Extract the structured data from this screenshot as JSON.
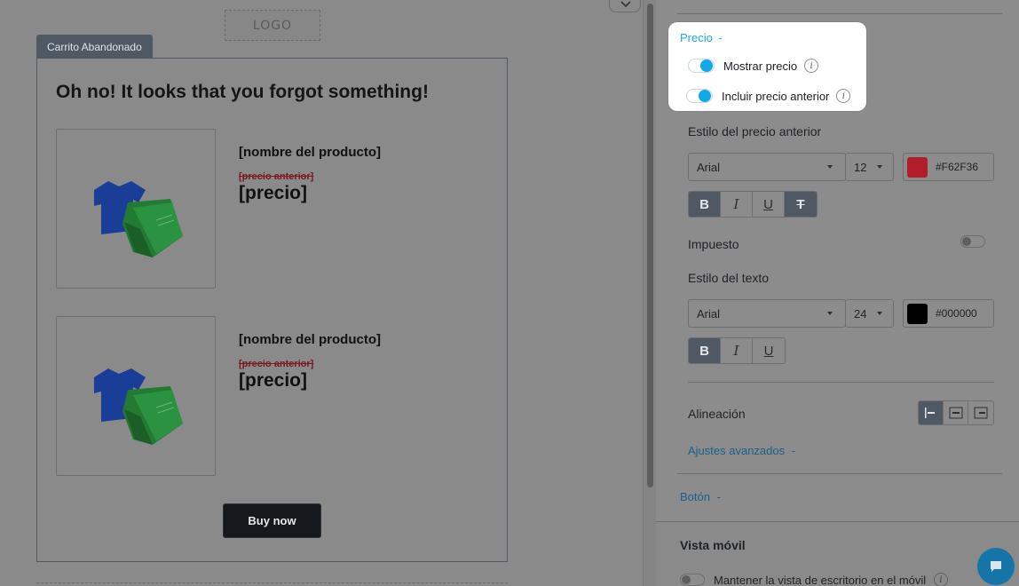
{
  "canvas": {
    "logo_text": "LOGO",
    "block_tab": "Carrito Abandonado",
    "heading": "Oh no! It looks that you forgot something!",
    "products": [
      {
        "name": "[nombre del producto]",
        "old_price": "[precio anterior]",
        "price": "[precio]"
      },
      {
        "name": "[nombre del producto]",
        "old_price": "[precio anterior]",
        "price": "[precio]"
      }
    ],
    "buy_button": "Buy now"
  },
  "panel": {
    "price_section": {
      "title": "Precio",
      "collapse_glyph": "-",
      "toggles": [
        {
          "label": "Mostrar precio",
          "on": true
        },
        {
          "label": "Incluir precio anterior",
          "on": true
        }
      ]
    },
    "old_price_style": {
      "label": "Estilo del precio anterior",
      "font": "Arial",
      "size": "12",
      "color_hex": "#F62F36",
      "swatch_color": "#b11d28",
      "format_buttons": [
        "B",
        "I",
        "U",
        "T"
      ],
      "active_buttons": [
        "B",
        "T"
      ]
    },
    "tax": {
      "label": "Impuesto",
      "on": false
    },
    "text_style": {
      "label": "Estilo del texto",
      "font": "Arial",
      "size": "24",
      "color_hex": "#000000",
      "swatch_color": "#000000",
      "format_buttons": [
        "B",
        "I",
        "U"
      ],
      "active_buttons": [
        "B"
      ]
    },
    "alignment": {
      "label": "Alineación",
      "options": [
        "left",
        "center",
        "right"
      ],
      "active": "left"
    },
    "advanced_link": "Ajustes avanzados",
    "advanced_glyph": "-",
    "button_section": "Botón",
    "button_glyph": "-",
    "mobile": {
      "title": "Vista móvil",
      "keep_desktop_label": "Mantener la vista de escritorio en el móvil",
      "keep_desktop_on": false
    }
  },
  "colors": {
    "accent": "#12a9ea",
    "overlay": "#8a8a8a",
    "chat": "#1574a8"
  }
}
